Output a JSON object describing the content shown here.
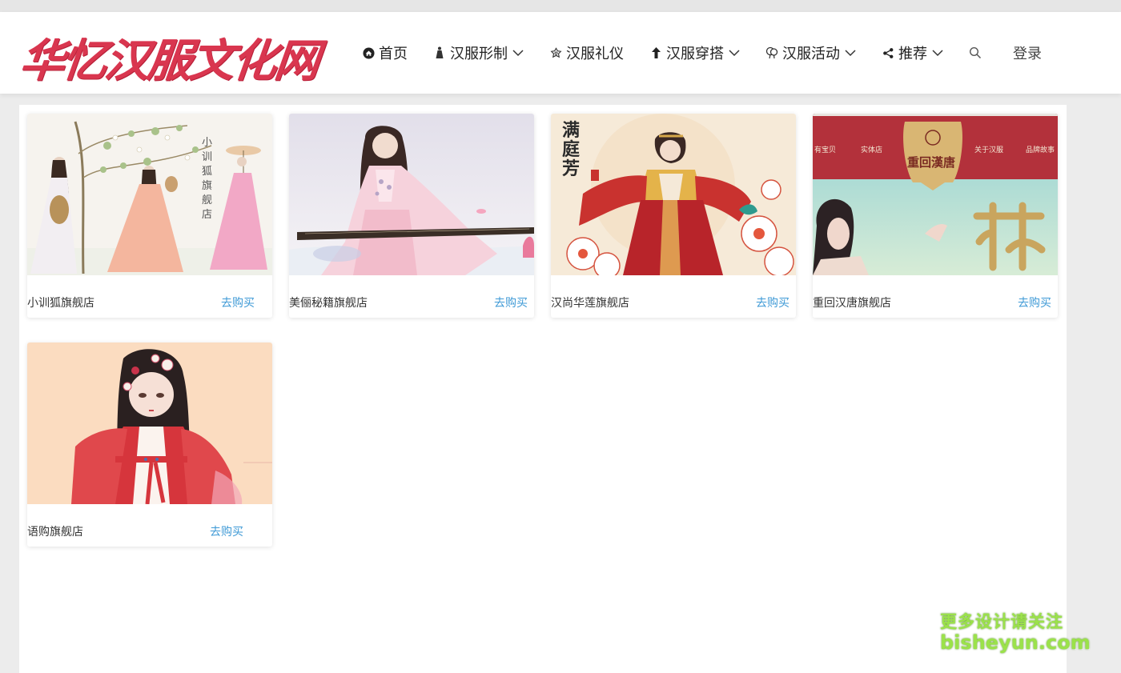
{
  "site": {
    "logo_text": "华忆汉服文化网",
    "accent_color": "#d9364f",
    "link_color": "#3f9ad6"
  },
  "nav": {
    "items": [
      {
        "label": "首页",
        "icon": "home-icon",
        "dropdown": false
      },
      {
        "label": "汉服形制",
        "icon": "figure-icon",
        "dropdown": true
      },
      {
        "label": "汉服礼仪",
        "icon": "flower-icon",
        "dropdown": false
      },
      {
        "label": "汉服穿搭",
        "icon": "arrow-up-icon",
        "dropdown": true
      },
      {
        "label": "汉服活动",
        "icon": "balloon-icon",
        "dropdown": true
      },
      {
        "label": "推荐",
        "icon": "share-icon",
        "dropdown": true
      }
    ],
    "search_icon": "search-icon",
    "login_label": "登录"
  },
  "shops": [
    {
      "name": "小训狐旗舰店",
      "buy_label": "去购买",
      "image_text": "小训狐旗舰店"
    },
    {
      "name": "美俪秘籍旗舰店",
      "buy_label": "去购买"
    },
    {
      "name": "汉尚华莲旗舰店",
      "buy_label": "去购买",
      "image_text": "满庭芳"
    },
    {
      "name": "重回汉唐旗舰店",
      "buy_label": "去购买",
      "image_text": "重回漢唐"
    },
    {
      "name": "语购旗舰店",
      "buy_label": "去购买"
    }
  ],
  "banner4_menu": [
    "有宝贝",
    "实体店",
    "关于汉服",
    "品牌故事"
  ],
  "watermark": {
    "line1": "更多设计请关注",
    "line2": "bisheyun.com"
  }
}
